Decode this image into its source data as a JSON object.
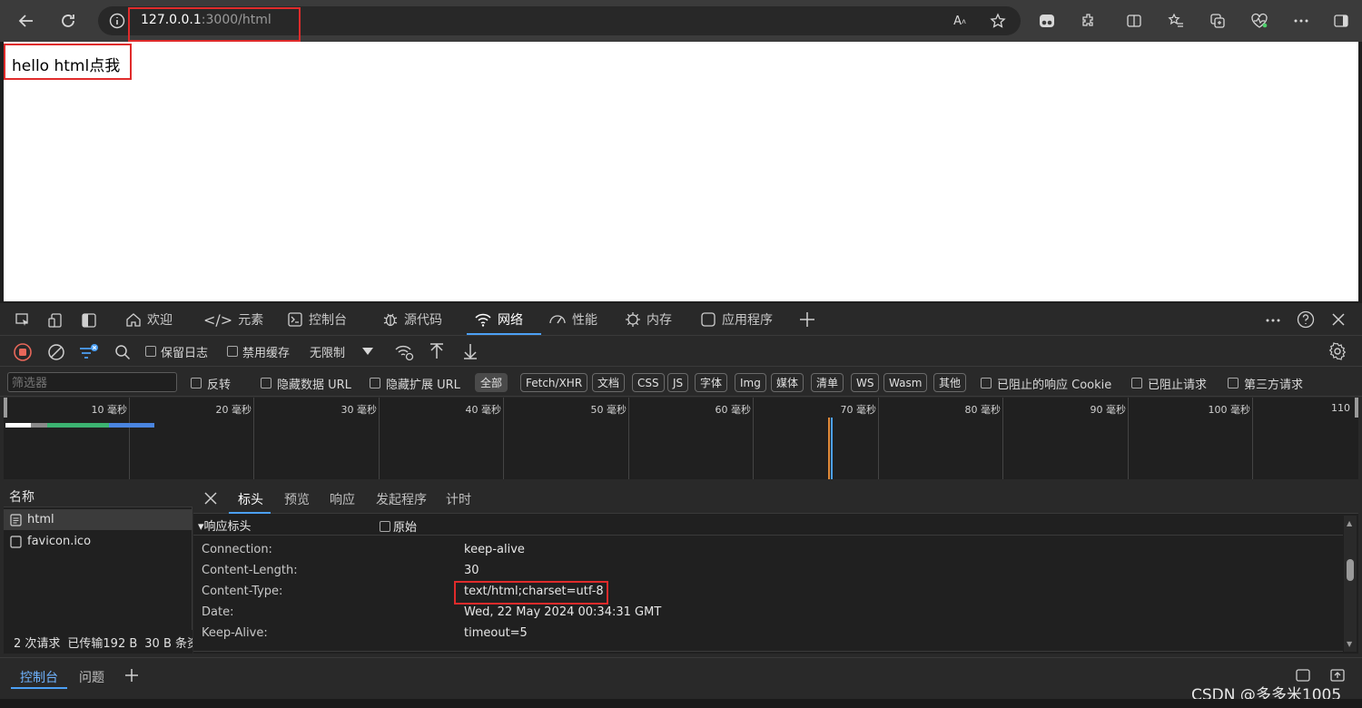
{
  "browser": {
    "url_host": "127.0.0.1",
    "url_path": ":3000/html"
  },
  "page": {
    "text": "hello html点我"
  },
  "devtools": {
    "tabs": [
      {
        "label": "欢迎",
        "icon": "home-icon"
      },
      {
        "label": "元素",
        "icon": "code-icon"
      },
      {
        "label": "控制台",
        "icon": "console-icon"
      },
      {
        "label": "源代码",
        "icon": "bug-icon"
      },
      {
        "label": "网络",
        "icon": "wifi-icon"
      },
      {
        "label": "性能",
        "icon": "gauge-icon"
      },
      {
        "label": "内存",
        "icon": "memory-icon"
      },
      {
        "label": "应用程序",
        "icon": "app-icon"
      }
    ],
    "active_tab": "网络",
    "network_toolbar": {
      "preserve_log": "保留日志",
      "disable_cache": "禁用缓存",
      "throttle": "无限制"
    },
    "filter": {
      "placeholder": "筛选器",
      "invert": "反转",
      "hide_data_url": "隐藏数据 URL",
      "hide_ext_url": "隐藏扩展 URL",
      "chips": [
        "全部",
        "Fetch/XHR",
        "文档",
        "CSS",
        "JS",
        "字体",
        "Img",
        "媒体",
        "清单",
        "WS",
        "Wasm",
        "其他"
      ],
      "active_chip": "全部",
      "blocked_cookies": "已阻止的响应 Cookie",
      "blocked_requests": "已阻止请求",
      "third_party": "第三方请求"
    },
    "timeline": {
      "ticks": [
        "10 毫秒",
        "20 毫秒",
        "30 毫秒",
        "40 毫秒",
        "50 毫秒",
        "60 毫秒",
        "70 毫秒",
        "80 毫秒",
        "90 毫秒",
        "100 毫秒",
        "110"
      ]
    },
    "requests": {
      "header": "名称",
      "items": [
        {
          "name": "html",
          "selected": true
        },
        {
          "name": "favicon.ico",
          "selected": false
        }
      ]
    },
    "details": {
      "tabs": [
        "标头",
        "预览",
        "响应",
        "发起程序",
        "计时"
      ],
      "active_tab": "标头",
      "section_title": "▾响应标头",
      "raw_label": "原始",
      "headers": [
        {
          "name": "Connection:",
          "value": "keep-alive"
        },
        {
          "name": "Content-Length:",
          "value": "30"
        },
        {
          "name": "Content-Type:",
          "value": "text/html;charset=utf-8"
        },
        {
          "name": "Date:",
          "value": "Wed, 22 May 2024 00:34:31 GMT"
        },
        {
          "name": "Keep-Alive:",
          "value": "timeout=5"
        }
      ]
    },
    "status": {
      "requests": "2 次请求",
      "transferred": "已传输192 B",
      "resources": "30 B 条资"
    },
    "drawer": {
      "tabs": [
        "控制台",
        "问题"
      ]
    }
  },
  "watermark": "CSDN @多多米1005"
}
